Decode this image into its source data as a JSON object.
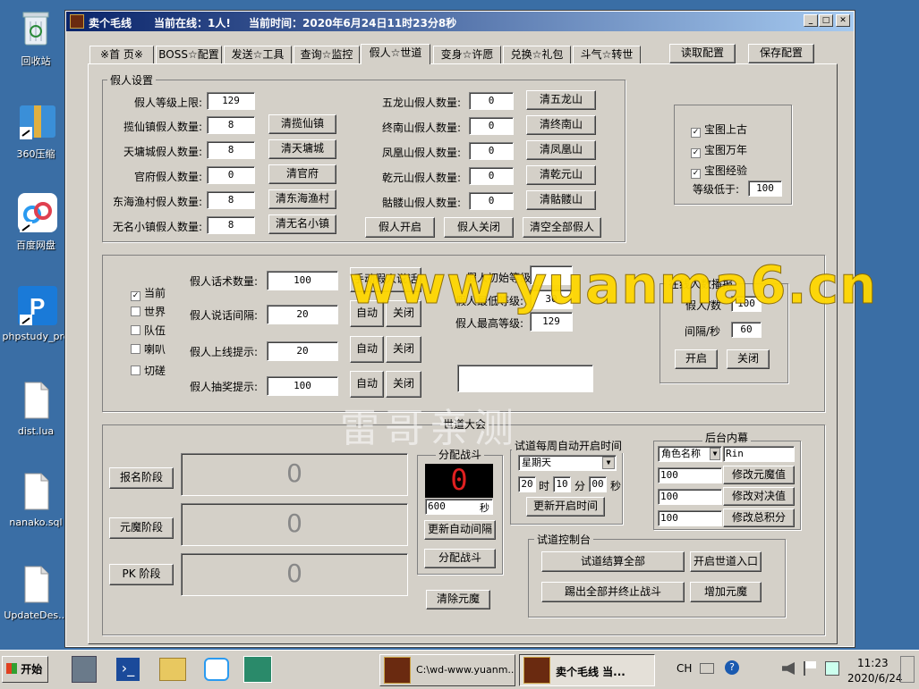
{
  "desktop": {
    "icons": [
      {
        "label": "回收站",
        "icon": "recycle-bin-icon"
      },
      {
        "label": "360压缩",
        "icon": "archive-icon"
      },
      {
        "label": "百度网盘",
        "icon": "cloud-icon"
      },
      {
        "label": "phpstudy_pro",
        "icon": "p-app-icon"
      },
      {
        "label": "dist.lua",
        "icon": "file-icon"
      },
      {
        "label": "nanako.sql",
        "icon": "file-icon"
      },
      {
        "label": "UpdateDes...",
        "icon": "file-icon"
      }
    ]
  },
  "window": {
    "title": "卖个毛线",
    "online_label": "当前在线：1人!",
    "time_label": "当前时间：2020年6月24日11时23分8秒",
    "tabs": [
      "※首 页※",
      "BOSS☆配置",
      "发送☆工具",
      "查询☆监控",
      "假人☆世道",
      "变身☆许愿",
      "兑换☆礼包",
      "斗气☆转世"
    ],
    "active_tab": "假人☆世道",
    "read_config": "读取配置",
    "save_config": "保存配置"
  },
  "fake_settings": {
    "title": "假人设置",
    "level_cap_label": "假人等级上限:",
    "level_cap": "129",
    "left_rows": [
      {
        "label": "揽仙镇假人数量:",
        "value": "8",
        "button": "清揽仙镇"
      },
      {
        "label": "天墉城假人数量:",
        "value": "8",
        "button": "清天墉城"
      },
      {
        "label": "官府假人数量:",
        "value": "0",
        "button": "清官府"
      },
      {
        "label": "东海渔村假人数量:",
        "value": "8",
        "button": "清东海渔村"
      },
      {
        "label": "无名小镇假人数量:",
        "value": "8",
        "button": "清无名小镇"
      }
    ],
    "right_rows": [
      {
        "label": "五龙山假人数量:",
        "value": "0",
        "button": "清五龙山"
      },
      {
        "label": "终南山假人数量:",
        "value": "0",
        "button": "清终南山"
      },
      {
        "label": "凤凰山假人数量:",
        "value": "0",
        "button": "清凤凰山"
      },
      {
        "label": "乾元山假人数量:",
        "value": "0",
        "button": "清乾元山"
      },
      {
        "label": "骷髅山假人数量:",
        "value": "0",
        "button": "清骷髅山"
      }
    ],
    "open_btn": "假人开启",
    "close_btn": "假人关闭",
    "clear_all_btn": "清空全部假人"
  },
  "treasure": {
    "checks": [
      "宝图上古",
      "宝图万年",
      "宝图经验"
    ],
    "level_below_label": "等级低于:",
    "level_below": "100"
  },
  "chat": {
    "channels": [
      {
        "label": "当前",
        "checked": true
      },
      {
        "label": "世界",
        "checked": false
      },
      {
        "label": "队伍",
        "checked": false
      },
      {
        "label": "喇叭",
        "checked": false
      },
      {
        "label": "切磋",
        "checked": false
      }
    ],
    "rows": [
      {
        "label": "假人话术数量:",
        "value": "100",
        "b1": "手动假人说话"
      },
      {
        "label": "假人说话间隔:",
        "value": "20",
        "b1": "自动",
        "b2": "关闭"
      },
      {
        "label": "假人上线提示:",
        "value": "20",
        "b1": "自动",
        "b2": "关闭"
      },
      {
        "label": "假人抽奖提示:",
        "value": "100",
        "b1": "自动",
        "b2": "关闭"
      }
    ],
    "init_level_label": "假人初始等级:",
    "min_level_label": "假人最低等级:",
    "min_level": "30",
    "max_level_label": "假人最高等级:",
    "max_level": "129"
  },
  "online_report": {
    "title": "在线人数播报",
    "per_label": "假人/数",
    "per_value": "100",
    "interval_label": "间隔/秒",
    "interval_value": "60",
    "open": "开启",
    "close": "关闭"
  },
  "trial": {
    "title": "世道大会",
    "stages": [
      "报名阶段",
      "元魔阶段",
      "PK 阶段"
    ],
    "stage_counts": [
      "0",
      "0",
      "0"
    ],
    "battle_title": "分配战斗",
    "battle_count": "0",
    "battle_seconds": "600",
    "seconds_unit": "秒",
    "update_interval": "更新自动间隔",
    "assign_battle": "分配战斗",
    "clear_yuanmo": "清除元魔",
    "weekly_title": "试道每周自动开启时间",
    "weekday": "星期天",
    "hour": "20",
    "hour_unit": "时",
    "minute": "10",
    "minute_unit": "分",
    "second": "00",
    "second_unit": "秒",
    "update_time": "更新开启时间",
    "console_title": "试道控制台",
    "settle_all": "试道结算全部",
    "open_entry": "开启世道入口",
    "kick_all": "踢出全部并终止战斗",
    "add_yuanmo": "增加元魔",
    "backstage_title": "后台内幕",
    "role_label": "角色名称",
    "role_value": "Rin",
    "mods": [
      {
        "value": "100",
        "button": "修改元魔值"
      },
      {
        "value": "100",
        "button": "修改对决值"
      },
      {
        "value": "100",
        "button": "修改总积分"
      }
    ]
  },
  "watermark": {
    "text": "www.yuanma6.cn",
    "text2": "雷哥亲测"
  },
  "taskbar": {
    "start": "开始",
    "tasks": [
      "C:\\wd-www.yuanm...",
      "卖个毛线   当..."
    ],
    "lang": "CH",
    "time": "11:23",
    "date": "2020/6/24"
  }
}
